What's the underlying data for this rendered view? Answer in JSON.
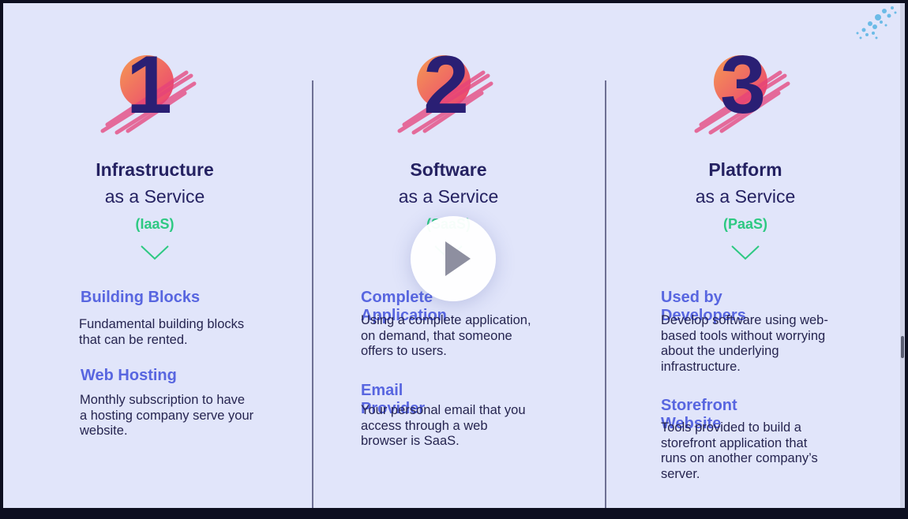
{
  "columns": [
    {
      "number": "1",
      "title": "Infrastructure",
      "subtitle": "as a Service",
      "abbr": "(IaaS)",
      "items": [
        {
          "heading": "Building Blocks",
          "text": "Fundamental building blocks\nthat can be rented."
        },
        {
          "heading": "Web Hosting",
          "text": "Monthly subscription to have\na hosting company serve your\nwebsite."
        }
      ]
    },
    {
      "number": "2",
      "title": "Software",
      "subtitle": "as a Service",
      "abbr": "(SaaS)",
      "items": [
        {
          "heading": "Complete Application",
          "text": "Using a complete application,\non demand, that someone\noffers to users."
        },
        {
          "heading": "Email Provider",
          "text": "Your personal email that you\naccess through a web\nbrowser is SaaS."
        }
      ]
    },
    {
      "number": "3",
      "title": "Platform",
      "subtitle": "as a Service",
      "abbr": "(PaaS)",
      "items": [
        {
          "heading": "Used by Developers",
          "text": "Develop software using web-\nbased tools without worrying\nabout the underlying\ninfrastructure."
        },
        {
          "heading": "Storefront Website",
          "text": "Tools provided to build a\nstorefront application that\nruns on another company’s\nserver."
        }
      ]
    }
  ],
  "video": {
    "play_icon": "play-icon"
  },
  "colors": {
    "background": "#e1e5fa",
    "heading": "#252262",
    "accent_green": "#2dc982",
    "accent_blue": "#5866e0",
    "number": "#2a1f74"
  }
}
